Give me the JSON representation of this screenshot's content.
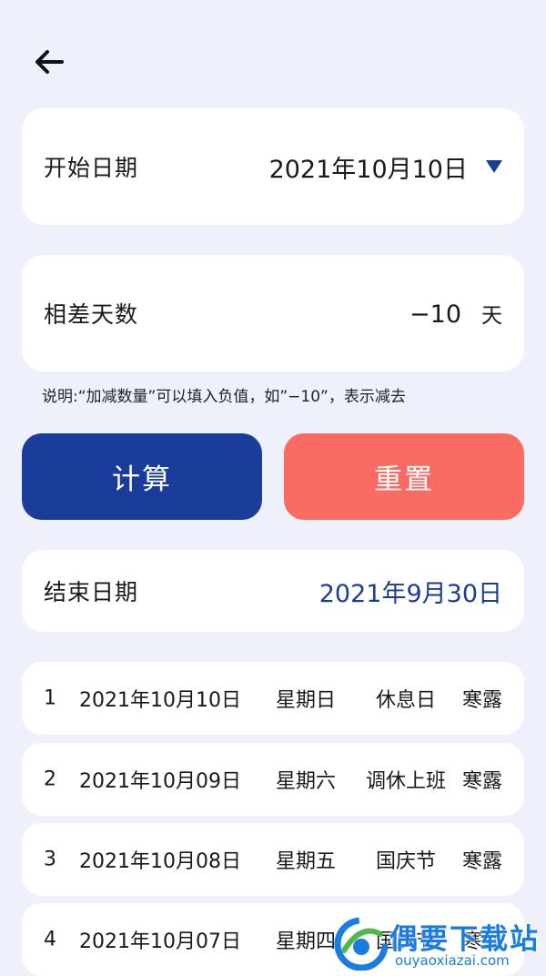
{
  "header": {
    "back_icon": "arrow-left-icon"
  },
  "start": {
    "label": "开始日期",
    "value": "2021年10月10日",
    "icon": "triangle-down-icon"
  },
  "diff": {
    "label": "相差天数",
    "value": "−10",
    "unit": "天"
  },
  "note": "说明:“加减数量”可以填入负值，如”−10”，表示减去",
  "buttons": {
    "calc": "计算",
    "reset": "重置"
  },
  "end": {
    "label": "结束日期",
    "value": "2021年9月30日"
  },
  "rows": [
    {
      "idx": "1",
      "date": "2021年10月10日",
      "weekday": "星期日",
      "type": "休息日",
      "term": "寒露"
    },
    {
      "idx": "2",
      "date": "2021年10月09日",
      "weekday": "星期六",
      "type": "调休上班",
      "term": "寒露"
    },
    {
      "idx": "3",
      "date": "2021年10月08日",
      "weekday": "星期五",
      "type": "国庆节",
      "term": "寒露"
    },
    {
      "idx": "4",
      "date": "2021年10月07日",
      "weekday": "星期四",
      "type": "国庆节",
      "term": "寒露"
    }
  ],
  "watermark": {
    "title": "偶要下载站",
    "subtitle": "ouyaoxiazai.com"
  },
  "colors": {
    "background": "#eef1fb",
    "primary": "#1a3d9c",
    "reset": "#fa6b64",
    "watermark": "#1a7be0"
  }
}
